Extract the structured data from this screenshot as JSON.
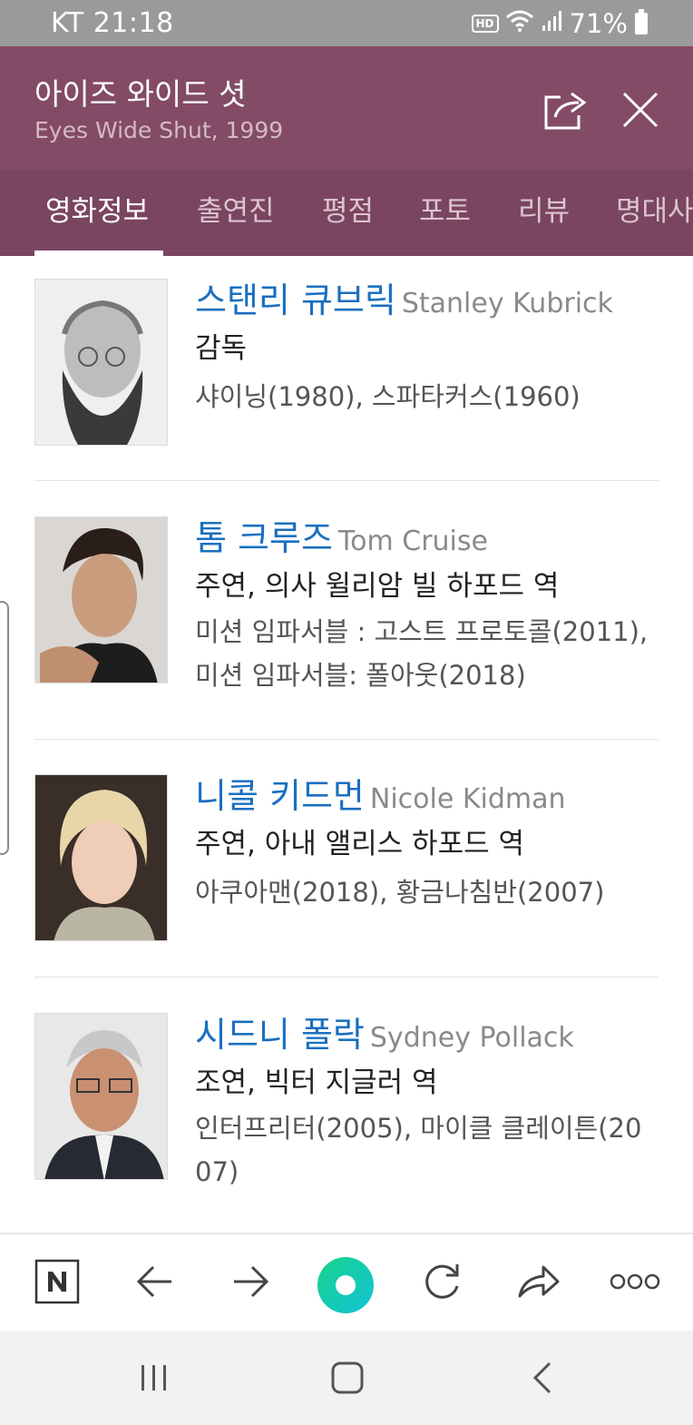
{
  "status_bar": {
    "carrier_time": "KT 21:18",
    "hd": "HD",
    "battery": "71%"
  },
  "header": {
    "title_ko": "아이즈 와이드 셧",
    "title_en": "Eyes Wide Shut, 1999"
  },
  "tabs": [
    {
      "label": "영화정보",
      "active": true
    },
    {
      "label": "출연진"
    },
    {
      "label": "평점"
    },
    {
      "label": "포토"
    },
    {
      "label": "리뷰"
    },
    {
      "label": "명대사"
    }
  ],
  "cast": [
    {
      "name_ko": "스탠리 큐브릭",
      "name_en": "Stanley Kubrick",
      "role": "감독",
      "works": "샤이닝(1980), 스파타커스(1960)"
    },
    {
      "name_ko": "톰 크루즈",
      "name_en": "Tom Cruise",
      "role": "주연, 의사 윌리암 빌 하포드 역",
      "works": "미션 임파서블 : 고스트 프로토콜(2011), 미션 임파서블: 폴아웃(2018)"
    },
    {
      "name_ko": "니콜 키드먼",
      "name_en": "Nicole Kidman",
      "role": "주연, 아내 앨리스 하포드 역",
      "works": "아쿠아맨(2018), 황금나침반(2007)"
    },
    {
      "name_ko": "시드니 폴락",
      "name_en": "Sydney Pollack",
      "role": "조연, 빅터 지글러 역",
      "works": "인터프리터(2005), 마이클 클레이튼(2007)"
    }
  ],
  "colors": {
    "header_bg": "#834b66",
    "tabs_bg": "#7a4560",
    "name_blue": "#1a6fc0",
    "accent_green": "#19d48c"
  },
  "toolbar": {
    "icons": [
      "naver-n-icon",
      "back-arrow-icon",
      "forward-arrow-icon",
      "green-dot-icon",
      "refresh-icon",
      "share-icon",
      "more-icon"
    ]
  }
}
